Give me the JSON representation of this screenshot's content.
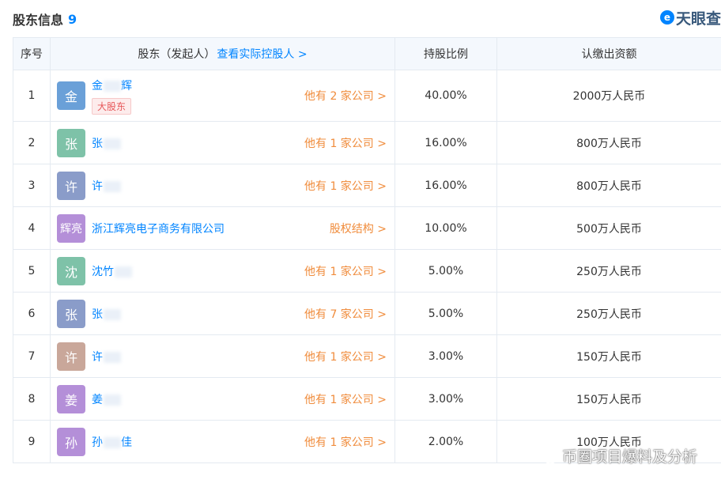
{
  "header": {
    "title": "股东信息",
    "count": "9"
  },
  "brand": {
    "icon": "e",
    "text": "天眼查"
  },
  "table": {
    "columns": {
      "index": "序号",
      "holder": "股东（发起人）",
      "holder_link": "查看实际控股人 >",
      "ratio": "持股比例",
      "amount": "认缴出资额"
    },
    "rows": [
      {
        "index": "1",
        "avatar": "金",
        "avatar_color": "#6aa0d8",
        "name": "金",
        "name_suffix": "辉",
        "tag": "大股东",
        "other": "他有 2 家公司 >",
        "ratio": "40.00%",
        "amount": "2000万人民币"
      },
      {
        "index": "2",
        "avatar": "张",
        "avatar_color": "#7ec2a8",
        "name": "张",
        "name_suffix": "",
        "tag": "",
        "other": "他有 1 家公司 >",
        "ratio": "16.00%",
        "amount": "800万人民币"
      },
      {
        "index": "3",
        "avatar": "许",
        "avatar_color": "#8a9cc9",
        "name": "许",
        "name_suffix": "",
        "tag": "",
        "other": "他有 1 家公司 >",
        "ratio": "16.00%",
        "amount": "800万人民币"
      },
      {
        "index": "4",
        "avatar": "辉亮",
        "avatar_color": "#b48fd8",
        "name": "浙江辉亮电子商务有限公司",
        "name_suffix": "",
        "tag": "",
        "other": "股权结构 >",
        "ratio": "10.00%",
        "amount": "500万人民币"
      },
      {
        "index": "5",
        "avatar": "沈",
        "avatar_color": "#7ec2a8",
        "name": "沈竹",
        "name_suffix": "",
        "tag": "",
        "other": "他有 1 家公司 >",
        "ratio": "5.00%",
        "amount": "250万人民币"
      },
      {
        "index": "6",
        "avatar": "张",
        "avatar_color": "#8a9cc9",
        "name": "张",
        "name_suffix": "",
        "tag": "",
        "other": "他有 7 家公司 >",
        "ratio": "5.00%",
        "amount": "250万人民币"
      },
      {
        "index": "7",
        "avatar": "许",
        "avatar_color": "#c9a79a",
        "name": "许",
        "name_suffix": "",
        "tag": "",
        "other": "他有 1 家公司 >",
        "ratio": "3.00%",
        "amount": "150万人民币"
      },
      {
        "index": "8",
        "avatar": "姜",
        "avatar_color": "#b48fd8",
        "name": "姜",
        "name_suffix": "",
        "tag": "",
        "other": "他有 1 家公司 >",
        "ratio": "3.00%",
        "amount": "150万人民币"
      },
      {
        "index": "9",
        "avatar": "孙",
        "avatar_color": "#b48fd8",
        "name": "孙",
        "name_suffix": "佳",
        "tag": "",
        "other": "他有 1 家公司 >",
        "ratio": "2.00%",
        "amount": "100万人民币"
      }
    ]
  },
  "watermark": {
    "text": "币圈项目爆料及分析"
  }
}
